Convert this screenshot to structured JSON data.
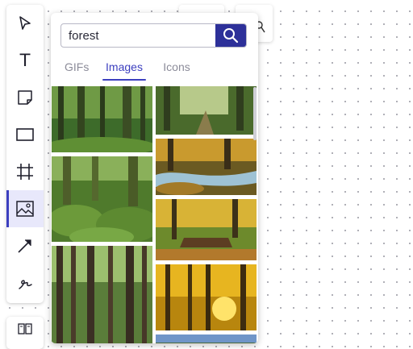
{
  "toolbar": {
    "tools": [
      {
        "name": "select",
        "icon": "cursor-arrow-icon"
      },
      {
        "name": "text",
        "icon": "text-icon",
        "glyph": "T"
      },
      {
        "name": "sticky-note",
        "icon": "sticky-note-icon"
      },
      {
        "name": "rectangle",
        "icon": "rectangle-icon"
      },
      {
        "name": "frame",
        "icon": "frame-icon"
      },
      {
        "name": "image",
        "icon": "image-icon",
        "active": true
      },
      {
        "name": "arrow",
        "icon": "arrow-line-icon"
      },
      {
        "name": "pen",
        "icon": "pen-scribble-icon"
      }
    ]
  },
  "media_picker": {
    "search": {
      "value": "forest",
      "icon": "search-icon"
    },
    "tabs": [
      {
        "label": "GIFs",
        "active": false
      },
      {
        "label": "Images",
        "active": true
      },
      {
        "label": "Icons",
        "active": false
      }
    ],
    "results": [
      {
        "column": 1,
        "subject": "green forest with mossy trees"
      },
      {
        "column": 1,
        "subject": "moss covered forest floor"
      },
      {
        "column": 1,
        "subject": "tall straight tree trunks"
      },
      {
        "column": 2,
        "subject": "misty forest path"
      },
      {
        "column": 2,
        "subject": "autumn forest stream"
      },
      {
        "column": 2,
        "subject": "wooden bridge in autumn forest"
      },
      {
        "column": 2,
        "subject": "golden sunlight through autumn trees"
      },
      {
        "column": 2,
        "subject": "blue sky forest"
      }
    ]
  },
  "colors": {
    "accent": "#3c3fbf",
    "search_button": "#2d3099",
    "tab_inactive": "#8b8b99"
  }
}
